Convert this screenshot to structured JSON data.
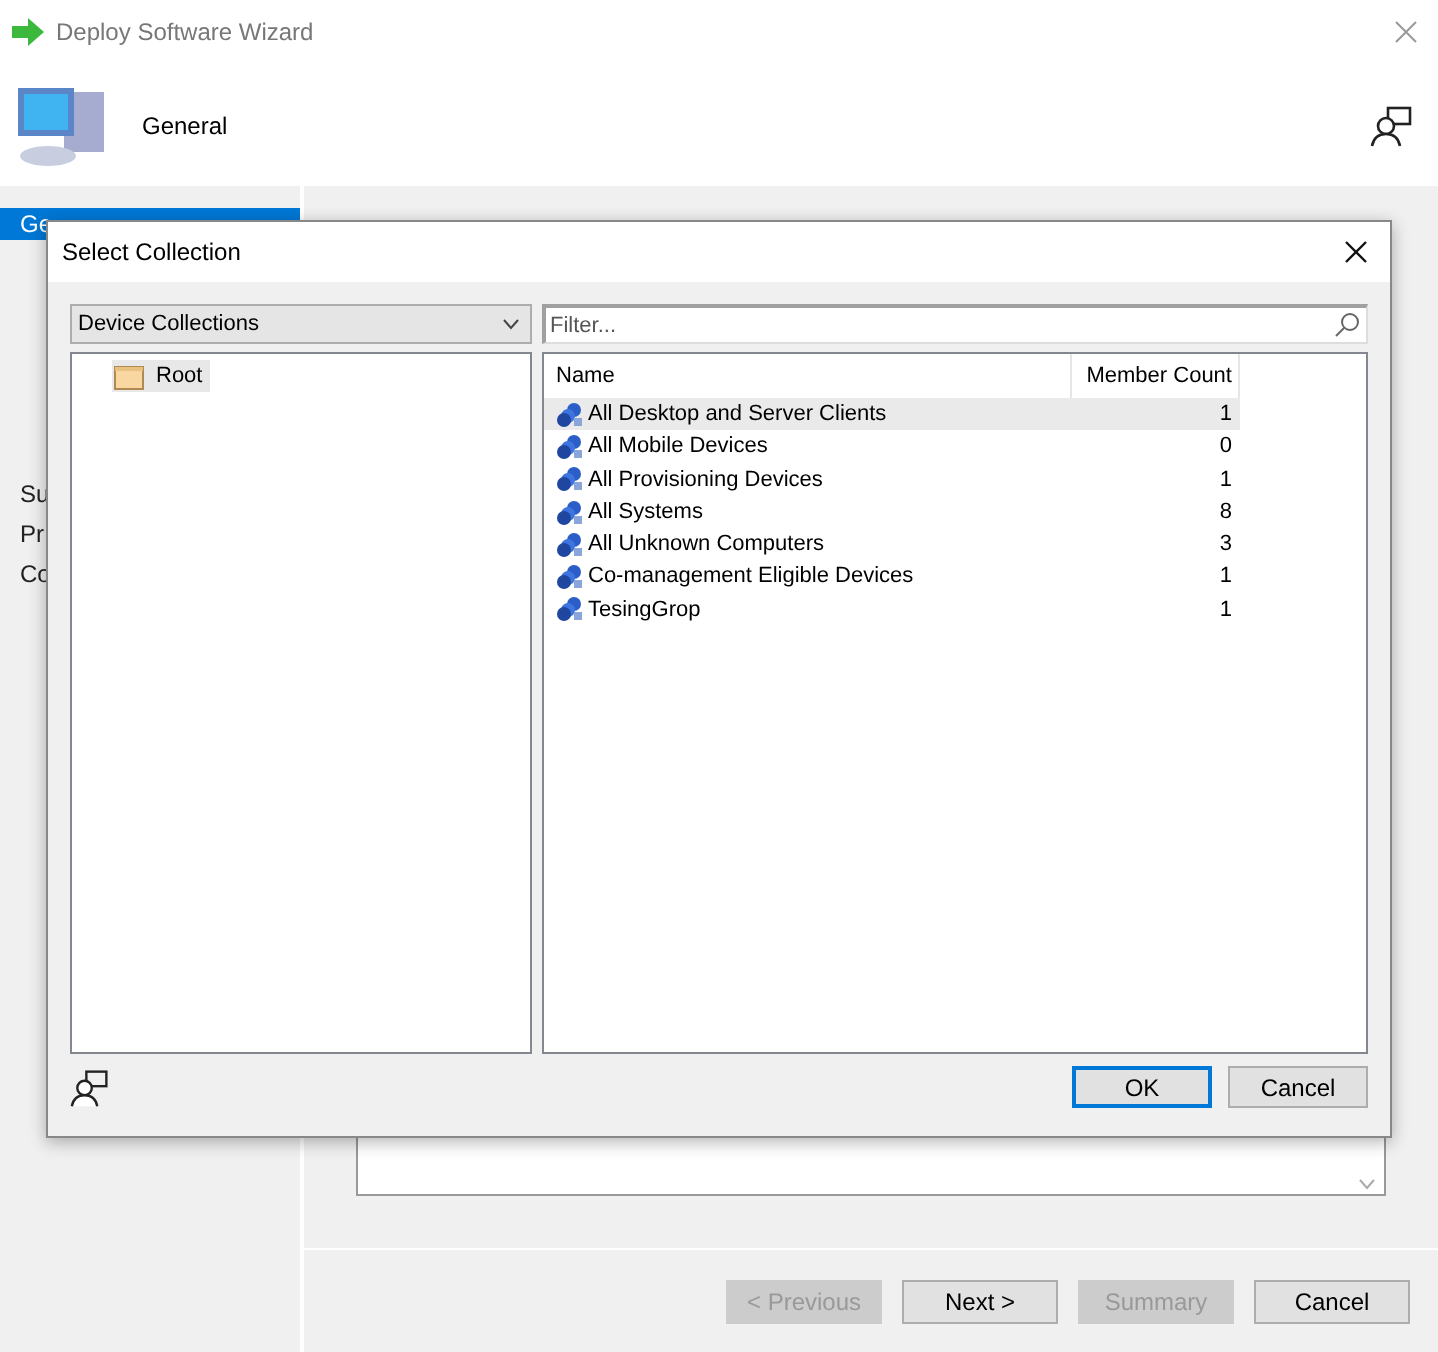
{
  "window": {
    "title": "Deploy Software Wizard"
  },
  "header": {
    "title": "General"
  },
  "sidebar": {
    "items": [
      {
        "label": "Ge",
        "selected": true
      },
      {
        "label": "Su",
        "selected": false
      },
      {
        "label": "Pr",
        "selected": false
      },
      {
        "label": "Co",
        "selected": false
      }
    ]
  },
  "buttons": [
    {
      "label": "< Previous",
      "disabled": true
    },
    {
      "label": "Next >",
      "disabled": false
    },
    {
      "label": "Summary",
      "disabled": true
    },
    {
      "label": "Cancel",
      "disabled": false
    }
  ],
  "dialog": {
    "title": "Select Collection",
    "collection_type": "Device Collections",
    "filter": {
      "placeholder": "Filter..."
    },
    "tree": [
      {
        "label": "Root",
        "selected": true
      }
    ],
    "table": {
      "columns": [
        "Name",
        "Member Count"
      ],
      "rows": [
        {
          "name": "All Desktop and Server Clients",
          "count": "1",
          "selected": true
        },
        {
          "name": "All Mobile Devices",
          "count": "0",
          "selected": false
        },
        {
          "name": "All Provisioning Devices",
          "count": "1",
          "selected": false
        },
        {
          "name": "All Systems",
          "count": "8",
          "selected": false
        },
        {
          "name": "All Unknown Computers",
          "count": "3",
          "selected": false
        },
        {
          "name": "Co-management Eligible Devices",
          "count": "1",
          "selected": false
        },
        {
          "name": "TesingGrop",
          "count": "1",
          "selected": false
        }
      ]
    },
    "buttons": [
      {
        "label": "OK",
        "default": true
      },
      {
        "label": "Cancel",
        "default": false
      }
    ]
  }
}
